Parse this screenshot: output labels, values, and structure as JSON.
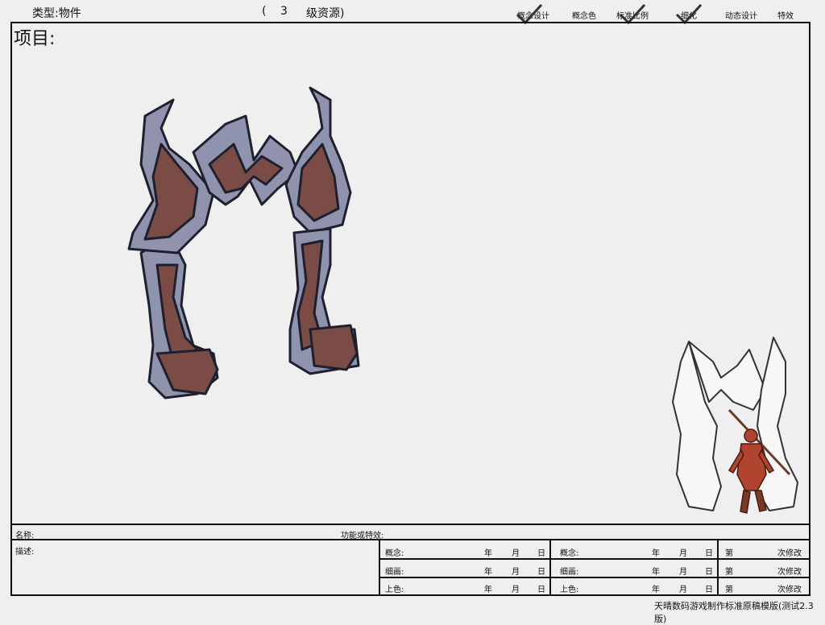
{
  "header": {
    "type_label": "类型:物件",
    "level_open": "(",
    "level_num": "3",
    "level_text": "级资源)",
    "stages": [
      "概念设计",
      "概念色",
      "标准比例",
      "细化",
      "动态设计",
      "特效"
    ],
    "checked": [
      true,
      false,
      true,
      true,
      false,
      false
    ]
  },
  "project_label": "项目:",
  "form": {
    "name_label": "名称:",
    "function_label": "功能或特效:",
    "desc_label": "描述:",
    "col1": [
      "概念:",
      "细画:",
      "上色:"
    ],
    "col2": [
      "概念:",
      "细画:",
      "上色:"
    ],
    "date_year": "年",
    "date_month": "月",
    "date_day": "日",
    "rev_prefix": "第",
    "rev_suffix": "次修改"
  },
  "footer": "天晴数码游戏制作标准原稿模版(测试2.3版)",
  "colors": {
    "metal": "#8f93ad",
    "wood": "#7a4c45",
    "outline": "#1e2030",
    "figure": "#b0442e"
  }
}
